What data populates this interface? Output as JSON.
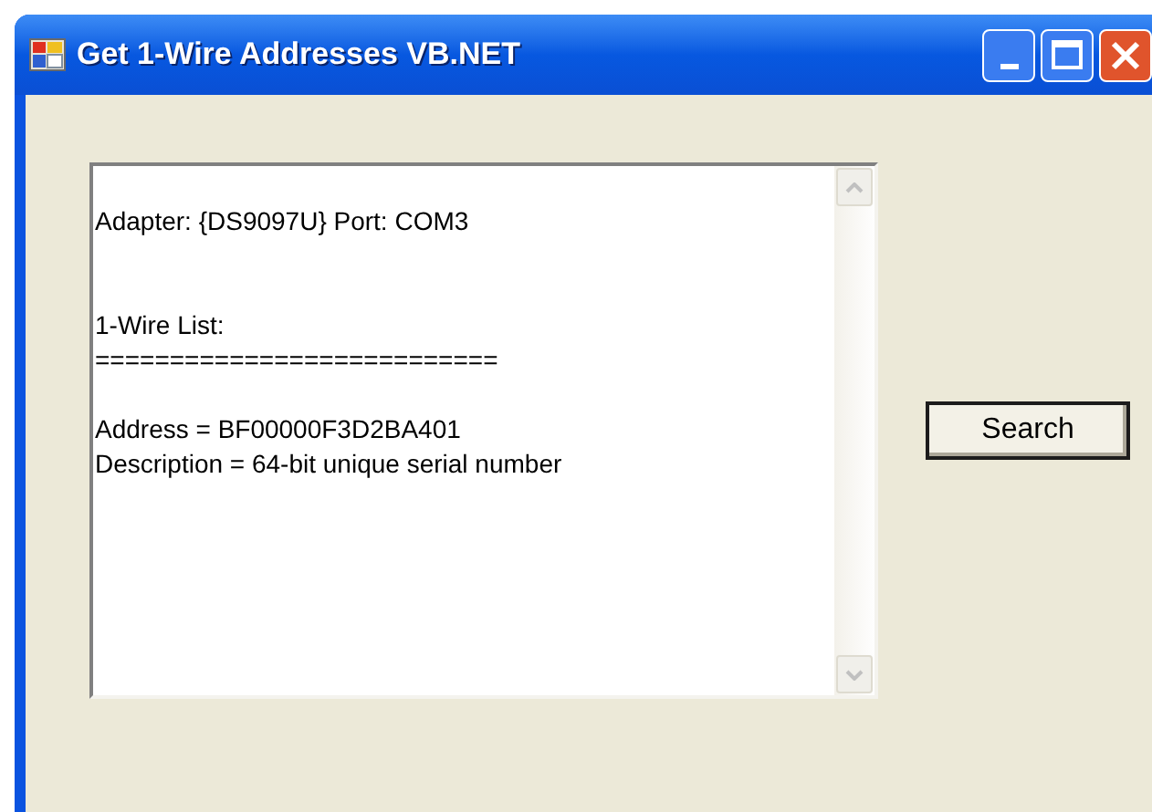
{
  "window": {
    "title": "Get 1-Wire Addresses VB.NET"
  },
  "output": {
    "value": "\nAdapter: {DS9097U} Port: COM3\n\n\n1-Wire List:\n===========================\n\nAddress = BF00000F3D2BA401\nDescription = 64-bit unique serial number"
  },
  "buttons": [
    {
      "label": "Search"
    }
  ]
}
